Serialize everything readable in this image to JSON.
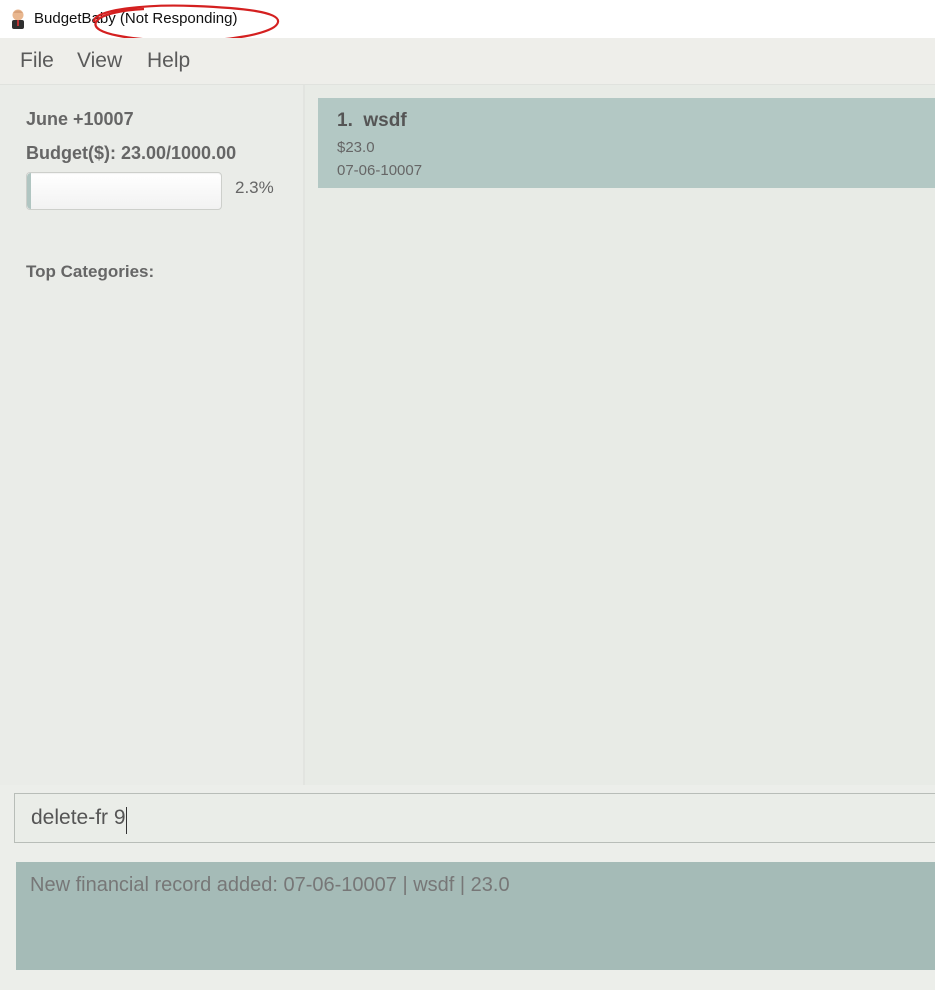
{
  "window": {
    "title": "BudgetBaby (Not Responding)",
    "icon": "boss-baby-app-icon"
  },
  "menu": {
    "file": "File",
    "view": "View",
    "help": "Help"
  },
  "sidebar": {
    "month": "June +10007",
    "budget": "Budget($): 23.00/1000.00",
    "progress_fraction": 0.023,
    "progress_label": "2.3%",
    "top_categories_label": "Top Categories:"
  },
  "records": [
    {
      "title": "1.  wsdf",
      "amount": "$23.0",
      "date": "07-06-10007"
    }
  ],
  "command": {
    "value": "delete-fr 9"
  },
  "result": {
    "message": "New financial record added: 07-06-10007 | wsdf | 23.0"
  },
  "colors": {
    "record_card": "#b3c8c4",
    "result_box": "#a5bbb7",
    "annotation_circle": "#d42020"
  }
}
